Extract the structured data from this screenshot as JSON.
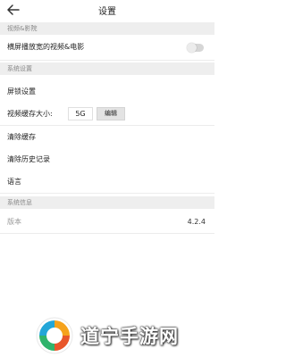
{
  "header": {
    "title": "设置"
  },
  "sections": {
    "video": {
      "title": "视频&影院"
    },
    "system_settings": {
      "title": "系统设置"
    },
    "system_info": {
      "title": "系统信息"
    }
  },
  "rows": {
    "landscape": {
      "label": "横屏播放宽的视频&电影",
      "enabled": false
    },
    "lock_screen": {
      "label": "屏锁设置"
    },
    "cache_size": {
      "label": "视频缓存大小:",
      "value": "5G",
      "edit_label": "编辑"
    },
    "clear_cache": {
      "label": "清除缓存"
    },
    "clear_history": {
      "label": "清除历史记录"
    },
    "language": {
      "label": "语言"
    },
    "version": {
      "label": "版本",
      "value": "4.2.4"
    }
  },
  "watermark": {
    "text": "道宁手游网"
  }
}
